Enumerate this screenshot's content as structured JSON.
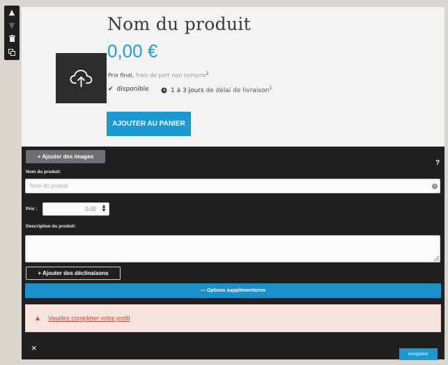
{
  "toolbar": {
    "up": "^",
    "down": "v",
    "delete": "🗑",
    "copy": "⧉"
  },
  "preview": {
    "title": "Nom du produit",
    "price": "0,00 €",
    "price_final": "Prix final,",
    "shipping_note": "frais de port non compris",
    "shipping_sup": "2",
    "availability": "disponible",
    "delivery_prefix": "1 à 3 jours",
    "delivery_suffix": "de délai de livraison",
    "delivery_sup": "1",
    "add_to_cart": "AJOUTER AU PANIER"
  },
  "editor": {
    "add_images": "+ Ajouter des images",
    "help": "?",
    "name_label": "Nom du produit:",
    "name_placeholder": "Nom du produit",
    "price_label": "Prix :",
    "price_value": "0,00",
    "desc_label": "Description du produit:",
    "add_variants": "+ Ajouter des déclinaisons",
    "options": "--- Options supplémentaires",
    "alert_text": "Veuillez compléter votre profil",
    "close": "×",
    "save": "enregistrer"
  },
  "colors": {
    "accent": "#1b9ad2",
    "editor_bg": "#1e2021",
    "alert_text": "#d9423a"
  }
}
